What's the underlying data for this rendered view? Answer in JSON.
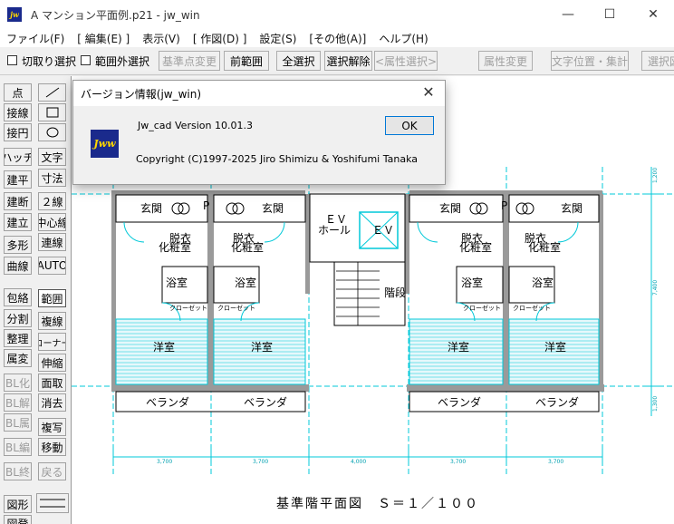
{
  "window": {
    "app_icon": "jw",
    "title": "A マンション平面例.p21 - jw_win",
    "minimize_icon": "minimize-icon",
    "maximize_icon": "maximize-icon",
    "close_icon": "close-icon"
  },
  "menu": [
    "ファイル(F)",
    "[ 編集(E) ]",
    "表示(V)",
    "[ 作図(D) ]",
    "設定(S)",
    "[その他(A)]",
    "ヘルプ(H)"
  ],
  "toolbar": {
    "chk_cut_select": "切取り選択",
    "chk_outside_select": "範囲外選択",
    "base_point_change": "基準点変更",
    "prev_range": "前範囲",
    "select_all": "全選択",
    "deselect": "選択解除",
    "attr_select": "<属性選択>",
    "attr_change": "属性変更",
    "text_pos_total": "文字位置・集計",
    "select_cut": "選択図"
  },
  "palette": {
    "left": [
      "点",
      "接線",
      "接円",
      "ハッチ",
      "建平",
      "建断",
      "建立",
      "多形",
      "曲線",
      "包絡",
      "分割",
      "整理",
      "属変",
      "BL化",
      "BL解",
      "BL属",
      "BL編",
      "BL終",
      "図形",
      "図登"
    ],
    "right": [
      "",
      "",
      "",
      "文字",
      "寸法",
      "２線",
      "中心線",
      "連線",
      "AUTO",
      "範囲",
      "複線",
      "コーナー",
      "伸縮",
      "面取",
      "消去",
      "複写",
      "移動",
      "戻る",
      ""
    ]
  },
  "drawing": {
    "caption": "基準階平面図　Ｓ＝１／１００",
    "rooms": {
      "entrance": "玄関",
      "p": "P",
      "powder": "化粧室",
      "dressing": "脱衣",
      "bath": "浴室",
      "closet": "クローゼット",
      "western": "洋室",
      "veranda": "ベランダ",
      "ev": "ＥＶ",
      "hall": "ホール",
      "ev2": "ＥＶ",
      "stairs": "階段"
    },
    "dims": [
      "3,700",
      "3,700",
      "4,000",
      "3,700",
      "3,700"
    ],
    "vdims": [
      "1,200",
      "7,400",
      "1,300"
    ]
  },
  "dialog": {
    "title": "バージョン情報(jw_win)",
    "version": "Jw_cad Version 10.01.3",
    "copyright": "Copyright (C)1997-2025 Jiro Shimizu  &  Yoshifumi Tanaka",
    "ok": "OK",
    "logo": "Jww"
  },
  "colors": {
    "cyan": "#00c8d8",
    "wall_gray": "#9a9a9a",
    "logo_bg": "#1a2a8c",
    "logo_fg": "#ffd700"
  }
}
